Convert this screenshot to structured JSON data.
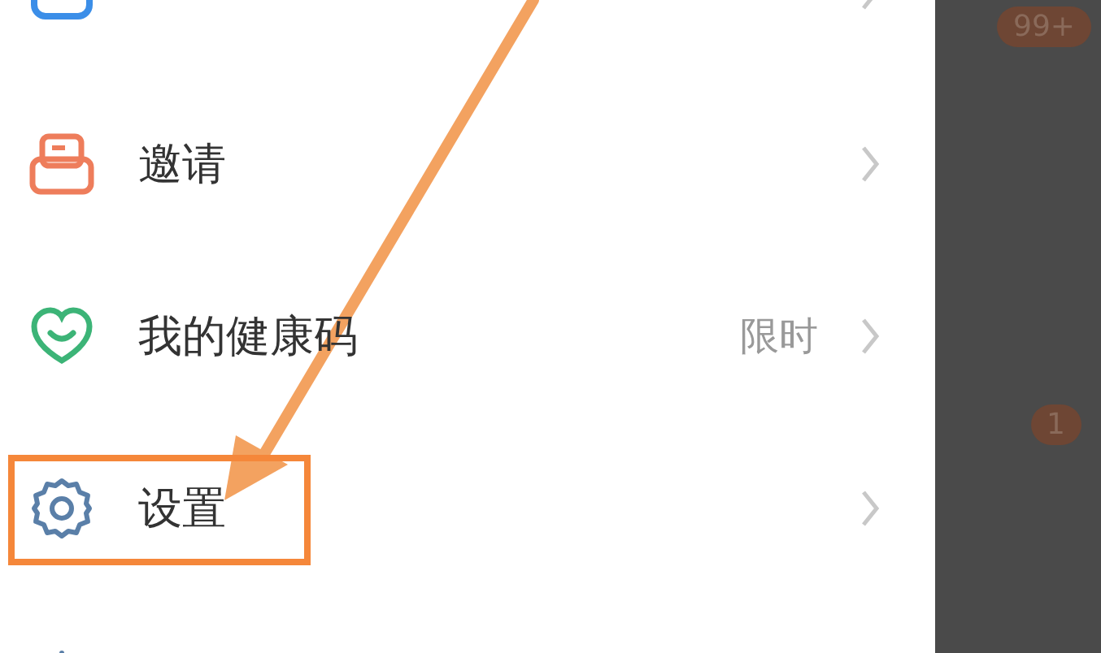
{
  "menu": {
    "items": [
      {
        "kind": "folder",
        "highlighted": false
      },
      {
        "kind": "invite",
        "label": "邀请",
        "highlighted": false
      },
      {
        "kind": "health",
        "label": "我的健康码",
        "tag": "限时",
        "highlighted": false
      },
      {
        "kind": "settings",
        "label": "设置",
        "highlighted": true
      },
      {
        "kind": "brightness",
        "highlighted": false
      }
    ]
  },
  "background_panel": {
    "badges": [
      {
        "text": "99+"
      },
      {
        "text": "1"
      }
    ]
  }
}
